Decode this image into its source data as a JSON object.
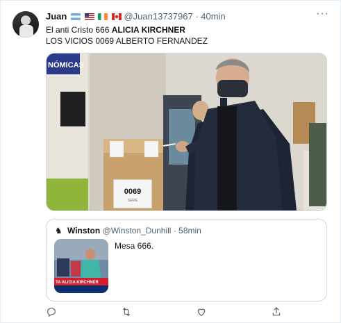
{
  "tweet": {
    "display_name": "Juan",
    "flags": [
      "flag-argentina-icon",
      "flag-usa-icon",
      "flag-ireland-icon",
      "flag-canada-icon"
    ],
    "handle": "@Juan13737967",
    "separator": "·",
    "time": "40min",
    "more": "···",
    "line1_prefix": "El anti Cristo 666 ",
    "line1_bold": "ALICIA KIRCHNER",
    "line2": "LOS VICIOS 0069 ALBERTO FERNANDEZ",
    "photo": {
      "sign_text": "NÓMICAS",
      "box_number": "0069",
      "box_caption": "SERIE"
    }
  },
  "quote": {
    "avatar_glyph": "♞",
    "display_name": "Winston",
    "handle": "@Winston_Dunhill",
    "separator": "·",
    "time": "58min",
    "text": "Mesa 666.",
    "thumb_banner": "TA ALICIA KIRCHNER"
  },
  "actions": [
    "reply-icon",
    "retweet-icon",
    "like-icon",
    "share-icon"
  ],
  "colors": {
    "text": "#0f1419",
    "secondary": "#536471",
    "border": "#cfd9de"
  }
}
